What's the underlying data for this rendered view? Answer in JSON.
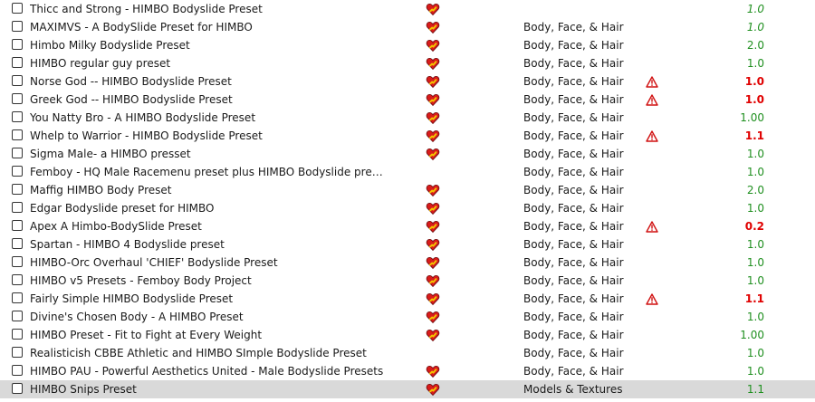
{
  "colors": {
    "version_ok": "#1f8f1f",
    "version_alert": "#e00000",
    "selected_row": "#d9d9d9"
  },
  "rows": [
    {
      "name": "Thicc and Strong - HIMBO Bodyslide Preset",
      "endorsed": true,
      "category": "",
      "warning": false,
      "version": "1.0",
      "version_style": "italic"
    },
    {
      "name": "MAXIMVS - A BodySlide Preset for HIMBO",
      "endorsed": true,
      "category": "Body, Face, & Hair",
      "warning": false,
      "version": "1.0",
      "version_style": "italic"
    },
    {
      "name": "Himbo Milky Bodyslide Preset",
      "endorsed": true,
      "category": "Body, Face, & Hair",
      "warning": false,
      "version": "2.0",
      "version_style": "ok"
    },
    {
      "name": "HIMBO regular guy preset",
      "endorsed": true,
      "category": "Body, Face, & Hair",
      "warning": false,
      "version": "1.0",
      "version_style": "ok"
    },
    {
      "name": "Norse God -- HIMBO Bodyslide Preset",
      "endorsed": true,
      "category": "Body, Face, & Hair",
      "warning": true,
      "version": "1.0",
      "version_style": "alert"
    },
    {
      "name": "Greek God -- HIMBO Bodyslide Preset",
      "endorsed": true,
      "category": "Body, Face, & Hair",
      "warning": true,
      "version": "1.0",
      "version_style": "alert"
    },
    {
      "name": "You Natty Bro - A HIMBO Bodyslide Preset",
      "endorsed": true,
      "category": "Body, Face, & Hair",
      "warning": false,
      "version": "1.00",
      "version_style": "ok"
    },
    {
      "name": "Whelp to Warrior - HIMBO Bodyslide Preset",
      "endorsed": true,
      "category": "Body, Face, & Hair",
      "warning": true,
      "version": "1.1",
      "version_style": "alert"
    },
    {
      "name": "Sigma Male- a HIMBO presset",
      "endorsed": true,
      "category": "Body, Face, & Hair",
      "warning": false,
      "version": "1.0",
      "version_style": "ok"
    },
    {
      "name": "Femboy - HQ Male Racemenu preset plus HIMBO Bodyslide pre…",
      "endorsed": false,
      "category": "Body, Face, & Hair",
      "warning": false,
      "version": "1.0",
      "version_style": "ok"
    },
    {
      "name": "Maffig HIMBO Body Preset",
      "endorsed": true,
      "category": "Body, Face, & Hair",
      "warning": false,
      "version": "2.0",
      "version_style": "ok"
    },
    {
      "name": "Edgar Bodyslide preset for HIMBO",
      "endorsed": true,
      "category": "Body, Face, & Hair",
      "warning": false,
      "version": "1.0",
      "version_style": "ok"
    },
    {
      "name": "Apex A Himbo-BodySlide Preset",
      "endorsed": true,
      "category": "Body, Face, & Hair",
      "warning": true,
      "version": "0.2",
      "version_style": "alert"
    },
    {
      "name": "Spartan - HIMBO 4 Bodyslide preset",
      "endorsed": true,
      "category": "Body, Face, & Hair",
      "warning": false,
      "version": "1.0",
      "version_style": "ok"
    },
    {
      "name": "HIMBO-Orc Overhaul 'CHIEF' Bodyslide Preset",
      "endorsed": true,
      "category": "Body, Face, & Hair",
      "warning": false,
      "version": "1.0",
      "version_style": "ok"
    },
    {
      "name": "HIMBO v5 Presets - Femboy Body Project",
      "endorsed": true,
      "category": "Body, Face, & Hair",
      "warning": false,
      "version": "1.0",
      "version_style": "ok"
    },
    {
      "name": "Fairly Simple HIMBO Bodyslide Preset",
      "endorsed": true,
      "category": "Body, Face, & Hair",
      "warning": true,
      "version": "1.1",
      "version_style": "alert"
    },
    {
      "name": "Divine's Chosen Body - A HIMBO Preset",
      "endorsed": true,
      "category": "Body, Face, & Hair",
      "warning": false,
      "version": "1.0",
      "version_style": "ok"
    },
    {
      "name": "HIMBO Preset - Fit to Fight at Every Weight",
      "endorsed": true,
      "category": "Body, Face, & Hair",
      "warning": false,
      "version": "1.00",
      "version_style": "ok"
    },
    {
      "name": "Realisticish CBBE Athletic and HIMBO SImple Bodyslide Preset",
      "endorsed": false,
      "category": "Body, Face, & Hair",
      "warning": false,
      "version": "1.0",
      "version_style": "ok"
    },
    {
      "name": "HIMBO PAU - Powerful Aesthetics United - Male Bodyslide Presets",
      "endorsed": true,
      "category": "Body, Face, & Hair",
      "warning": false,
      "version": "1.0",
      "version_style": "ok"
    },
    {
      "name": "HIMBO Snips Preset",
      "endorsed": true,
      "category": "Models & Textures",
      "warning": false,
      "version": "1.1",
      "version_style": "ok",
      "selected": true
    }
  ]
}
